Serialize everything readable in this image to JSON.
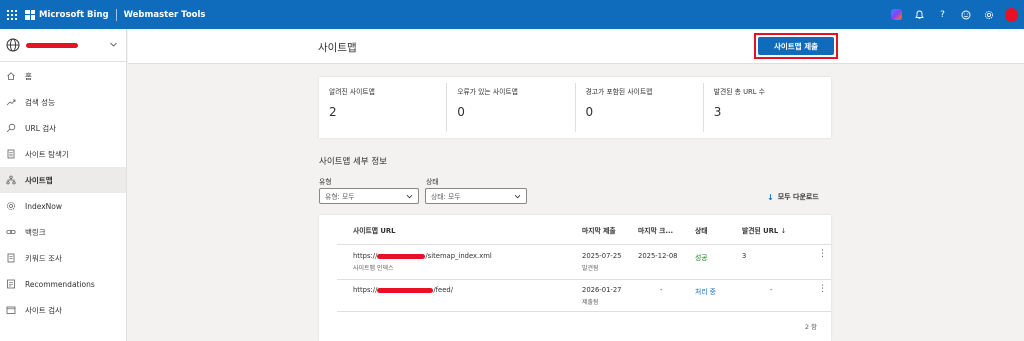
{
  "topbar": {
    "brand": "Microsoft Bing",
    "product": "Webmaster Tools",
    "icons": [
      "copilot-icon",
      "bell-icon",
      "help-icon",
      "feedback-smiley-icon",
      "settings-gear-icon",
      "avatar"
    ]
  },
  "sidebar": {
    "items": [
      {
        "label": "홈",
        "icon": "home-icon"
      },
      {
        "label": "검색 성능",
        "icon": "trend-icon"
      },
      {
        "label": "URL 검사",
        "icon": "search-icon"
      },
      {
        "label": "사이트 탐색기",
        "icon": "document-icon"
      },
      {
        "label": "사이트맵",
        "icon": "sitemap-icon"
      },
      {
        "label": "IndexNow",
        "icon": "gear-icon"
      },
      {
        "label": "백링크",
        "icon": "link-icon"
      },
      {
        "label": "키워드 조사",
        "icon": "document-icon"
      },
      {
        "label": "Recommendations",
        "icon": "list-icon"
      },
      {
        "label": "사이트 검사",
        "icon": "browser-icon"
      }
    ]
  },
  "header": {
    "title": "사이트맵",
    "submit_label": "사이트맵 제출"
  },
  "stats": [
    {
      "label": "알려진 사이트맵",
      "value": "2"
    },
    {
      "label": "오류가 있는 사이트맵",
      "value": "0"
    },
    {
      "label": "경고가 포함된 사이트맵",
      "value": "0"
    },
    {
      "label": "발견된 총 URL 수",
      "value": "3"
    }
  ],
  "details": {
    "title": "사이트맵 세부 정보",
    "type_label": "유형",
    "type_value": "유형: 모두",
    "status_label": "상태",
    "status_value": "상태: 모두",
    "download_label": "모두 다운로드"
  },
  "table": {
    "columns": [
      "사이트맵 URL",
      "마지막 제출",
      "마지막 크...",
      "상태",
      "발견된 URL"
    ],
    "rows": [
      {
        "url_prefix": "https://",
        "url_suffix": "/sitemap_index.xml",
        "url_sub": "사이트맵 인덱스",
        "submitted": "2025-07-25",
        "submitted_sub": "발견됨",
        "crawled": "2025-12-08",
        "status": "성공",
        "discovered": "3"
      },
      {
        "url_prefix": "https://",
        "url_suffix": "/feed/",
        "url_sub": "",
        "submitted": "2026-01-27",
        "submitted_sub": "제출됨",
        "crawled": "-",
        "status": "처리 중",
        "discovered": "-"
      }
    ],
    "count": "2 항"
  },
  "colors": {
    "accent": "#0f6cbd",
    "highlight": "#e81123",
    "success": "#107c10"
  }
}
